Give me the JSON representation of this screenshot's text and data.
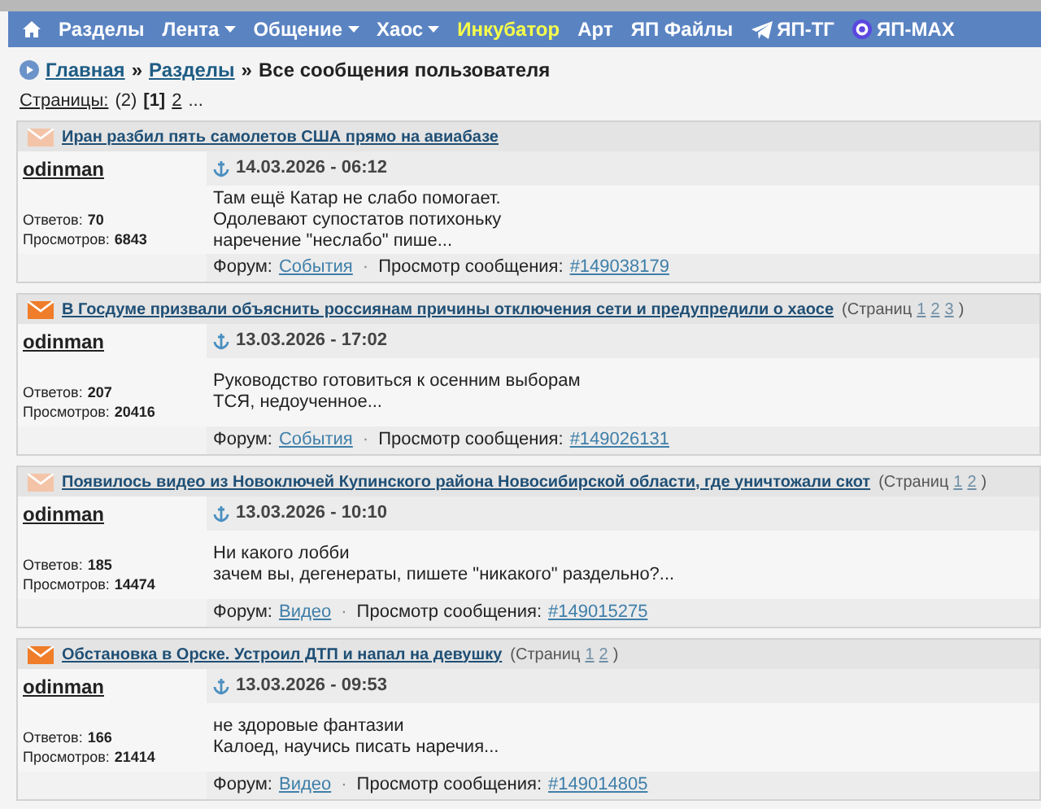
{
  "nav": {
    "items": [
      {
        "label": "Разделы",
        "kind": "plain"
      },
      {
        "label": "Лента",
        "kind": "dropdown"
      },
      {
        "label": "Общение",
        "kind": "dropdown"
      },
      {
        "label": "Хаос",
        "kind": "dropdown"
      },
      {
        "label": "Инкубатор",
        "kind": "highlight"
      },
      {
        "label": "Арт",
        "kind": "plain"
      },
      {
        "label": "ЯП Файлы",
        "kind": "plain"
      },
      {
        "label": "ЯП-ТГ",
        "kind": "telegram"
      },
      {
        "label": "ЯП-МАХ",
        "kind": "max"
      }
    ]
  },
  "breadcrumb": {
    "links": [
      "Главная",
      "Разделы"
    ],
    "separator": "»",
    "current": "Все сообщения пользователя"
  },
  "pagination": {
    "label": "Страницы:",
    "total": "(2)",
    "pages": [
      {
        "label": "[1]",
        "selected": true
      },
      {
        "label": "2",
        "selected": false
      }
    ],
    "more": "..."
  },
  "posts": [
    {
      "title": "Иран разбил пять самолетов США прямо на авиабазе",
      "new": false,
      "author": "odinman",
      "date": "14.03.2026 - 06:12",
      "replies_label": "Ответов:",
      "replies": "70",
      "views_label": "Просмотров:",
      "views": "6843",
      "lines": [
        "Там ещё Катар не слабо помогает.",
        "Одолевают супостатов потихоньку",
        "наречение \"неслабо\" пише..."
      ],
      "forum_label": "Форум:",
      "forum": "События",
      "separator": "·",
      "view_label": "Просмотр сообщения:",
      "post_id": "#149038179"
    },
    {
      "title": "В Госдуме призвали объяснить россиянам причины отключения сети и предупредили о хаосе",
      "new": true,
      "pages_label": "(Страниц",
      "pages": [
        "1",
        "2",
        "3"
      ],
      "pages_close": ")",
      "author": "odinman",
      "date": "13.03.2026 - 17:02",
      "replies_label": "Ответов:",
      "replies": "207",
      "views_label": "Просмотров:",
      "views": "20416",
      "lines": [
        "Руководство готовиться к осенним выборам",
        "ТСЯ, недоученное..."
      ],
      "forum_label": "Форум:",
      "forum": "События",
      "separator": "·",
      "view_label": "Просмотр сообщения:",
      "post_id": "#149026131"
    },
    {
      "title": "Появилось видео из Новоключей Купинского района Новосибирской области, где уничтожали скот",
      "new": false,
      "pages_label": "(Страниц",
      "pages": [
        "1",
        "2"
      ],
      "pages_close": ")",
      "author": "odinman",
      "date": "13.03.2026 - 10:10",
      "replies_label": "Ответов:",
      "replies": "185",
      "views_label": "Просмотров:",
      "views": "14474",
      "lines": [
        "Ни какого лобби",
        "зачем вы, дегенераты, пишете \"никакого\" раздельно?..."
      ],
      "forum_label": "Форум:",
      "forum": "Видео",
      "separator": "·",
      "view_label": "Просмотр сообщения:",
      "post_id": "#149015275"
    },
    {
      "title": "Обстановка в Орске. Устроил ДТП и напал на девушку",
      "new": true,
      "pages_label": "(Страниц",
      "pages": [
        "1",
        "2"
      ],
      "pages_close": ")",
      "author": "odinman",
      "date": "13.03.2026 - 09:53",
      "replies_label": "Ответов:",
      "replies": "166",
      "views_label": "Просмотров:",
      "views": "21414",
      "lines": [
        "не здоровые фантазии",
        "Калоед, научись писать наречия..."
      ],
      "forum_label": "Форум:",
      "forum": "Видео",
      "separator": "·",
      "view_label": "Просмотр сообщения:",
      "post_id": "#149014805"
    }
  ]
}
